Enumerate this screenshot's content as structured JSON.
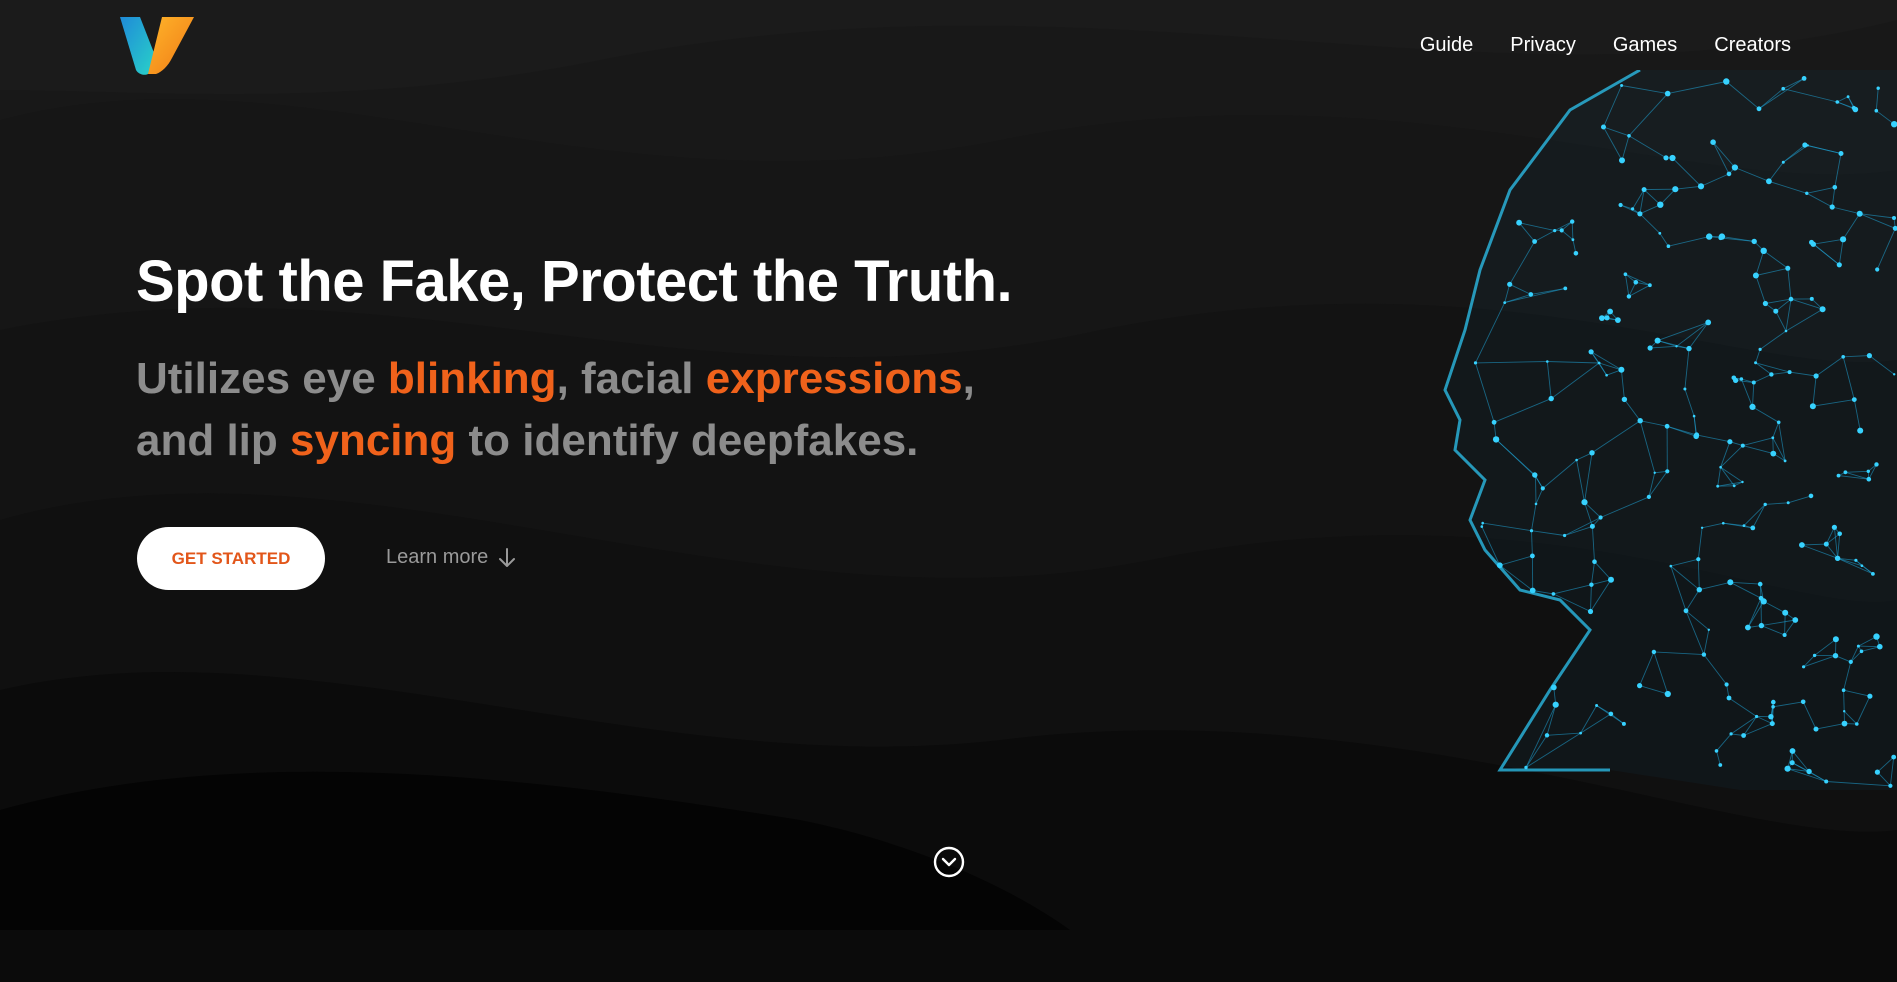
{
  "brand": {
    "logo_icon": "v-logo-icon",
    "colors": {
      "teal": "#1fb6d6",
      "orange": "#f5a21d",
      "accent": "#f0621b"
    }
  },
  "nav": {
    "items": [
      "Guide",
      "Privacy",
      "Games",
      "Creators"
    ]
  },
  "hero": {
    "headline": "Spot the Fake, Protect the Truth.",
    "subline": {
      "p1": "Utilizes eye ",
      "h1": "blinking",
      "p2": ", facial ",
      "h2": "expressions",
      "p3": ",",
      "p4": "and lip ",
      "h3": "syncing",
      "p5": " to identify deepfakes."
    },
    "cta_label": "GET STARTED",
    "learn_more_label": "Learn more",
    "learn_more_icon": "arrow-down-icon",
    "image": "wireframe-face-illustration",
    "scroll_icon": "chevron-down-circle-icon"
  }
}
